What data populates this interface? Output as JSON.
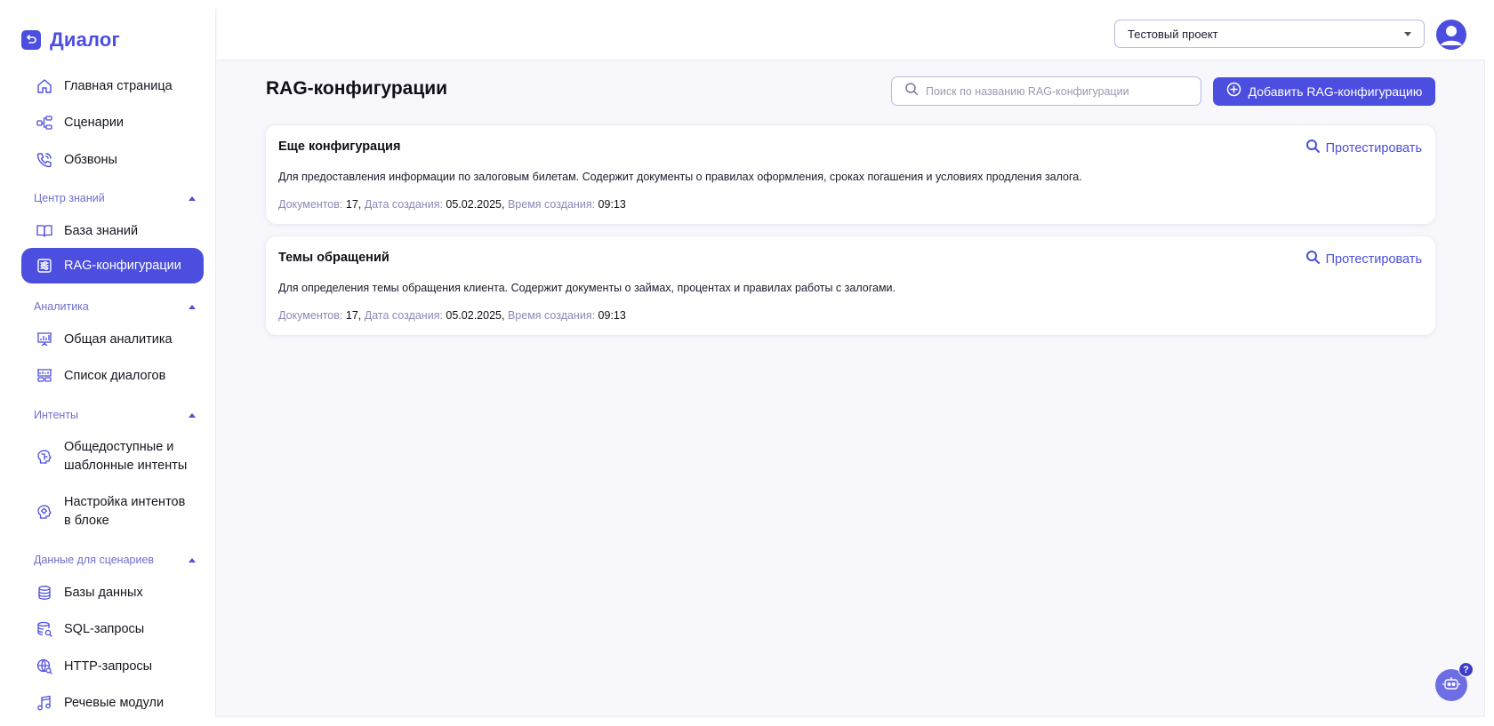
{
  "app": {
    "logo_text": "Диалог"
  },
  "sidebar": {
    "items_top": [
      {
        "label": "Главная страница",
        "icon": "home-icon"
      },
      {
        "label": "Сценарии",
        "icon": "scenarios-icon"
      },
      {
        "label": "Обзвоны",
        "icon": "phone-icon"
      }
    ],
    "sections": [
      {
        "label": "Центр знаний",
        "items": [
          {
            "label": "База знаний",
            "icon": "book-icon"
          },
          {
            "label": "RAG-конфигурации",
            "icon": "sliders-icon",
            "active": true
          }
        ]
      },
      {
        "label": "Аналитика",
        "items": [
          {
            "label": "Общая аналитика",
            "icon": "presentation-chart-icon"
          },
          {
            "label": "Список диалогов",
            "icon": "dialog-list-icon"
          }
        ]
      },
      {
        "label": "Интенты",
        "items": [
          {
            "label_line1": "Общедоступные и",
            "label_line2": "шаблонные интенты",
            "icon": "brain-icon"
          },
          {
            "label_line1": "Настройка интентов",
            "label_line2": "в блоке",
            "icon": "brain-gear-icon"
          }
        ]
      },
      {
        "label": "Данные для сценариев",
        "items": [
          {
            "label": "Базы данных",
            "icon": "database-icon"
          },
          {
            "label": "SQL-запросы",
            "icon": "database-search-icon"
          },
          {
            "label": "HTTP-запросы",
            "icon": "globe-search-icon"
          },
          {
            "label": "Речевые модули",
            "icon": "music-note-icon"
          }
        ]
      }
    ]
  },
  "header": {
    "project_select_value": "Тестовый проект"
  },
  "main": {
    "title": "RAG-конфигурации",
    "search_placeholder": "Поиск по названию RAG-конфигурации",
    "add_button_label": "Добавить RAG-конфигурацию",
    "meta_labels": {
      "docs": "Документов:",
      "created_date": "Дата создания:",
      "created_time": "Время создания:"
    },
    "cards": [
      {
        "title": "Еще конфигурация",
        "description": "Для предоставления информации по залоговым билетам. Содержит документы о правилах оформления, сроках погашения и условиях продления залога.",
        "docs": "17",
        "date": "05.02.2025",
        "time": "09:13",
        "action_label": "Протестировать"
      },
      {
        "title": "Темы обращений",
        "description": "Для определения темы обращения клиента. Содержит документы о займах, процентах и правилах работы с залогами.",
        "docs": "17",
        "date": "05.02.2025",
        "time": "09:13",
        "action_label": "Протестировать"
      }
    ]
  },
  "help": {
    "badge": "?"
  },
  "colors": {
    "accent": "#4b4ede",
    "section_label": "#6f6fcf",
    "meta_key": "#8a8ab8"
  }
}
